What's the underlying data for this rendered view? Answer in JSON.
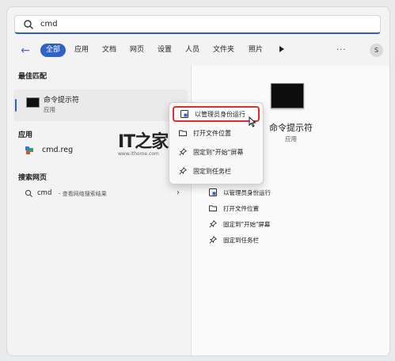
{
  "search": {
    "query": "cmd"
  },
  "filters": {
    "back": "←",
    "chips": [
      "全部",
      "应用",
      "文档",
      "网页",
      "设置",
      "人员",
      "文件夹",
      "照片"
    ],
    "more": "...",
    "avatar": "S"
  },
  "left": {
    "best_match_title": "最佳匹配",
    "best_match": {
      "name": "命令提示符",
      "type": "应用"
    },
    "apps_title": "应用",
    "app": {
      "name": "cmd.reg"
    },
    "web_title": "搜索网页",
    "web": {
      "query": "cmd",
      "desc": "- 查看网络搜索结果",
      "chevron": "›"
    }
  },
  "right": {
    "title": "命令提示符",
    "subtitle": "应用",
    "actions": [
      "以管理员身份运行",
      "打开文件位置",
      "固定到\"开始\"屏幕",
      "固定到任务栏"
    ]
  },
  "context_menu": {
    "items": [
      "以管理员身份运行",
      "打开文件位置",
      "固定到\"开始\"屏幕",
      "固定到任务栏"
    ]
  },
  "watermark": {
    "logo": "IT之家",
    "url": "www.ithome.com"
  },
  "colors": {
    "accent": "#2f62c8",
    "highlight_border": "#d9302c"
  }
}
